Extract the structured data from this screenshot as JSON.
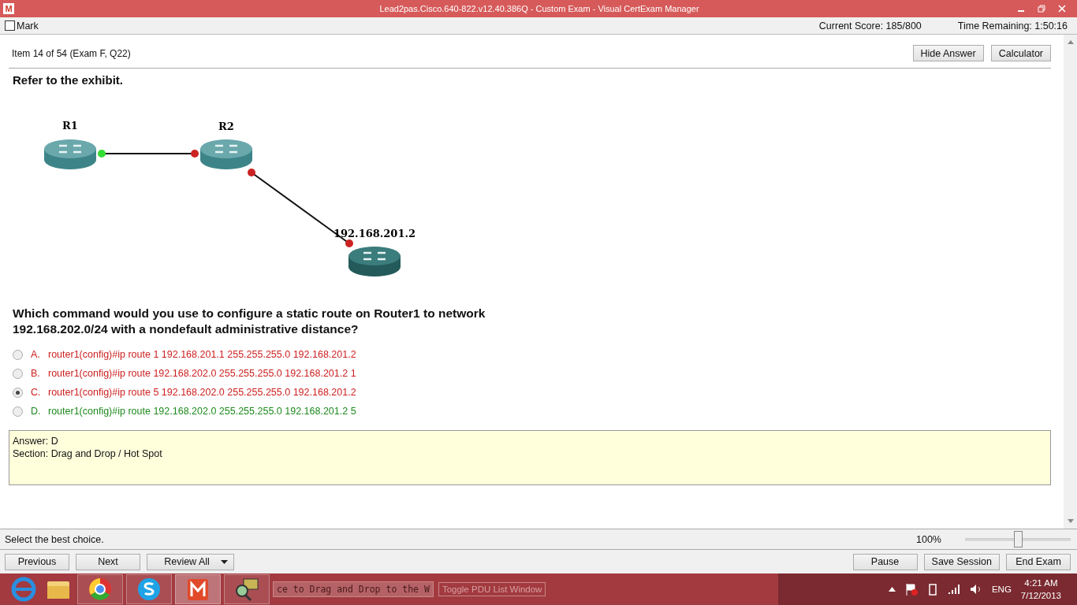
{
  "window": {
    "title": "Lead2pas.Cisco.640-822.v12.40.386Q - Custom Exam - Visual CertExam Manager",
    "app_letter": "M"
  },
  "topbar": {
    "mark": {
      "label": "Mark",
      "checked": false
    },
    "score": "Current Score: 185/800",
    "time": "Time Remaining: 1:50:16"
  },
  "header": {
    "item": "Item 14 of 54  (Exam F, Q22)",
    "buttons": [
      "Hide Answer",
      "Calculator"
    ]
  },
  "intro": "Refer to the exhibit.",
  "exhibit": {
    "nodes": [
      {
        "label": "R1"
      },
      {
        "label": "R2"
      },
      {
        "label": "192.168.201.2"
      }
    ],
    "ports": [
      {
        "color": "#33dd33"
      },
      {
        "color": "#cc2222"
      },
      {
        "color": "#cc2222"
      },
      {
        "color": "#cc2222"
      }
    ]
  },
  "question": "Which command would you use to configure a static route on Router1 to network 192.168.202.0/24 with a nondefault administrative distance?",
  "options": [
    {
      "letter": "A.",
      "text": "router1(config)#ip route 1 192.168.201.1 255.255.255.0 192.168.201.2",
      "selected": false,
      "correct": false
    },
    {
      "letter": "B.",
      "text": "router1(config)#ip route 192.168.202.0 255.255.255.0 192.168.201.2 1",
      "selected": false,
      "correct": false
    },
    {
      "letter": "C.",
      "text": "router1(config)#ip route 5 192.168.202.0 255.255.255.0 192.168.201.2",
      "selected": true,
      "correct": false
    },
    {
      "letter": "D.",
      "text": "router1(config)#ip route 192.168.202.0 255.255.255.0 192.168.201.2 5",
      "selected": false,
      "correct": true
    }
  ],
  "answer": {
    "lines": [
      "Answer: D",
      "Section: Drag and Drop / Hot Spot"
    ]
  },
  "status_bar": {
    "hint": "Select the best choice.",
    "zoom": "100%",
    "level": 0.5
  },
  "nav": {
    "left": [
      "Previous",
      "Next"
    ],
    "review": "Review All",
    "right": [
      "Pause",
      "Save Session",
      "End Exam"
    ]
  },
  "taskbar": {
    "behind": [
      "ce to Drag and Drop to the W",
      "Toggle PDU List Window"
    ],
    "lang": "ENG",
    "time": "4:21 AM",
    "date": "7/12/2013"
  }
}
